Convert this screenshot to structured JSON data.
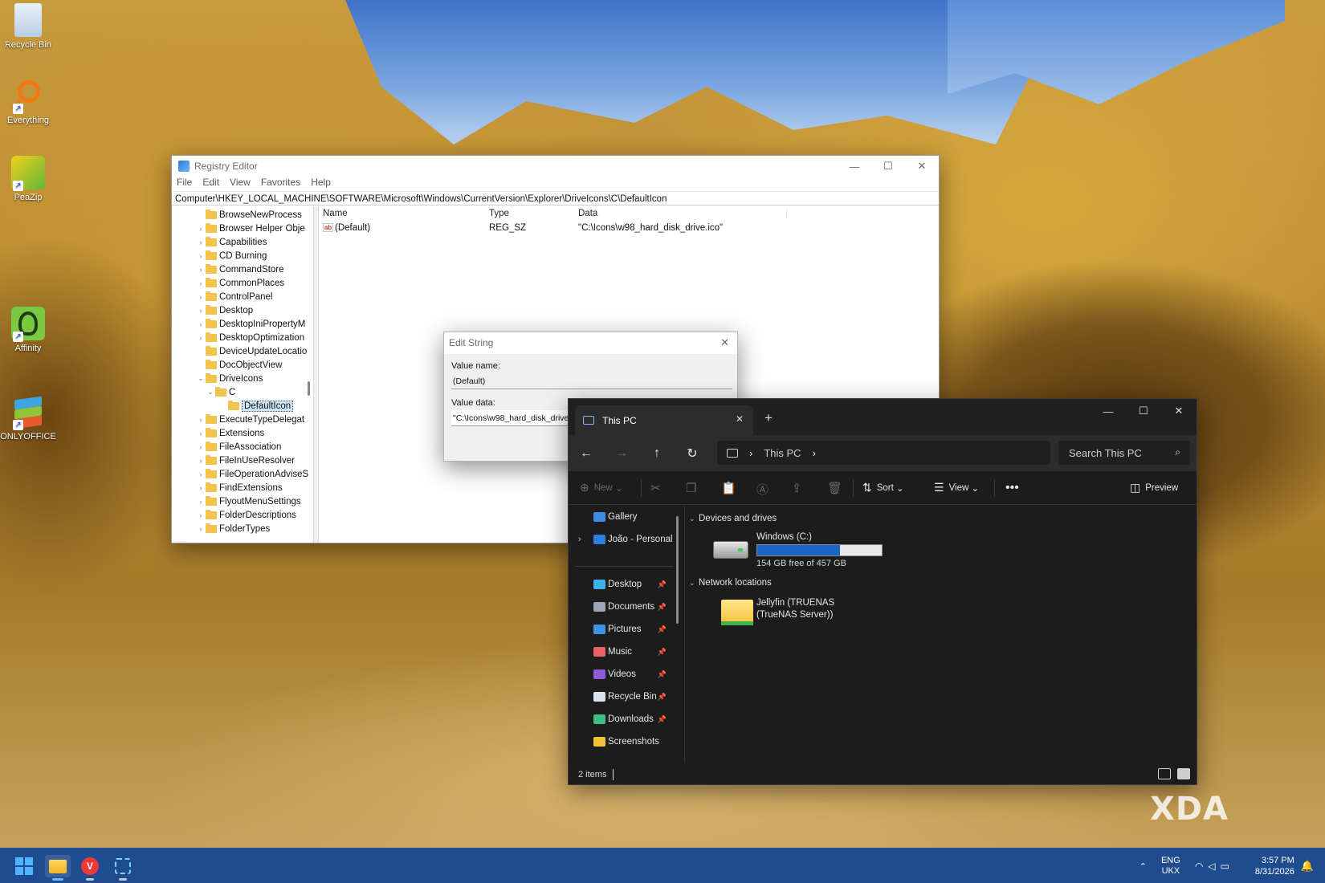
{
  "desktop": {
    "icons": [
      {
        "label": "Recycle Bin",
        "icon": "recycle-bin-icon"
      },
      {
        "label": "Everything",
        "icon": "everything-search-icon"
      },
      {
        "label": "PeaZip",
        "icon": "peazip-icon"
      },
      {
        "label": "Affinity",
        "icon": "affinity-icon"
      },
      {
        "label": "ONLYOFFICE",
        "icon": "onlyoffice-icon"
      }
    ]
  },
  "registry": {
    "title": "Registry Editor",
    "menu": [
      "File",
      "Edit",
      "View",
      "Favorites",
      "Help"
    ],
    "address": "Computer\\HKEY_LOCAL_MACHINE\\SOFTWARE\\Microsoft\\Windows\\CurrentVersion\\Explorer\\DriveIcons\\C\\DefaultIcon",
    "tree": [
      {
        "label": "BrowseNewProcess",
        "chev": ""
      },
      {
        "label": "Browser Helper Obje",
        "chev": "›"
      },
      {
        "label": "Capabilities",
        "chev": "›"
      },
      {
        "label": "CD Burning",
        "chev": "›"
      },
      {
        "label": "CommandStore",
        "chev": "›"
      },
      {
        "label": "CommonPlaces",
        "chev": "›"
      },
      {
        "label": "ControlPanel",
        "chev": "›"
      },
      {
        "label": "Desktop",
        "chev": "›"
      },
      {
        "label": "DesktopIniPropertyM",
        "chev": "›"
      },
      {
        "label": "DesktopOptimization",
        "chev": "›"
      },
      {
        "label": "DeviceUpdateLocatio",
        "chev": ""
      },
      {
        "label": "DocObjectView",
        "chev": ""
      },
      {
        "label": "DriveIcons",
        "chev": "⌄"
      },
      {
        "label": "C",
        "chev": "⌄"
      },
      {
        "label": "DefaultIcon",
        "chev": ""
      },
      {
        "label": "ExecuteTypeDelegat",
        "chev": "›"
      },
      {
        "label": "Extensions",
        "chev": "›"
      },
      {
        "label": "FileAssociation",
        "chev": "›"
      },
      {
        "label": "FileInUseResolver",
        "chev": "›"
      },
      {
        "label": "FileOperationAdviseS",
        "chev": "›"
      },
      {
        "label": "FindExtensions",
        "chev": "›"
      },
      {
        "label": "FlyoutMenuSettings",
        "chev": "›"
      },
      {
        "label": "FolderDescriptions",
        "chev": "›"
      },
      {
        "label": "FolderTypes",
        "chev": "›"
      }
    ],
    "columns": {
      "name": "Name",
      "type": "Type",
      "data": "Data"
    },
    "rows": [
      {
        "name": "(Default)",
        "type": "REG_SZ",
        "data": "\"C:\\Icons\\w98_hard_disk_drive.ico\""
      }
    ]
  },
  "edit_string": {
    "title": "Edit String",
    "value_name_label": "Value name:",
    "value_name": "(Default)",
    "value_data_label": "Value data:",
    "value_data": "\"C:\\Icons\\w98_hard_disk_drive.ico\""
  },
  "explorer": {
    "tab_title": "This PC",
    "breadcrumb": "This PC",
    "search_placeholder": "Search This PC",
    "commands": {
      "new": "New",
      "sort": "Sort",
      "view": "View",
      "preview": "Preview"
    },
    "sidebar": [
      {
        "label": "Gallery",
        "color": "#3d8be6",
        "pin": false
      },
      {
        "label": "João - Personal",
        "color": "#2f7fe0",
        "pin": false
      },
      {
        "label": "Desktop",
        "color": "#3db2ea",
        "pin": true
      },
      {
        "label": "Documents",
        "color": "#9aa6b8",
        "pin": true
      },
      {
        "label": "Pictures",
        "color": "#3f93e8",
        "pin": true
      },
      {
        "label": "Music",
        "color": "#e8616a",
        "pin": true
      },
      {
        "label": "Videos",
        "color": "#8e5bd8",
        "pin": true
      },
      {
        "label": "Recycle Bin",
        "color": "#d8e4f0",
        "pin": true
      },
      {
        "label": "Downloads",
        "color": "#3dbf7e",
        "pin": true
      },
      {
        "label": "Screenshots",
        "color": "#f2c138",
        "pin": false
      }
    ],
    "groups": {
      "devices": "Devices and drives",
      "network": "Network locations"
    },
    "drive": {
      "name": "Windows (C:)",
      "free_text": "154 GB free of 457 GB",
      "used_fraction": 0.663
    },
    "network_item": "Jellyfin (TRUENAS (TrueNAS Server))",
    "status": "2 items"
  },
  "watermark": "XDA",
  "taskbar": {
    "apps": [
      "start-icon",
      "file-explorer-icon",
      "vivaldi-icon",
      "snipping-tool-icon"
    ],
    "lang_1": "ENG",
    "lang_2": "UKX",
    "time": "3:57 PM",
    "date": "8/31/2026"
  }
}
